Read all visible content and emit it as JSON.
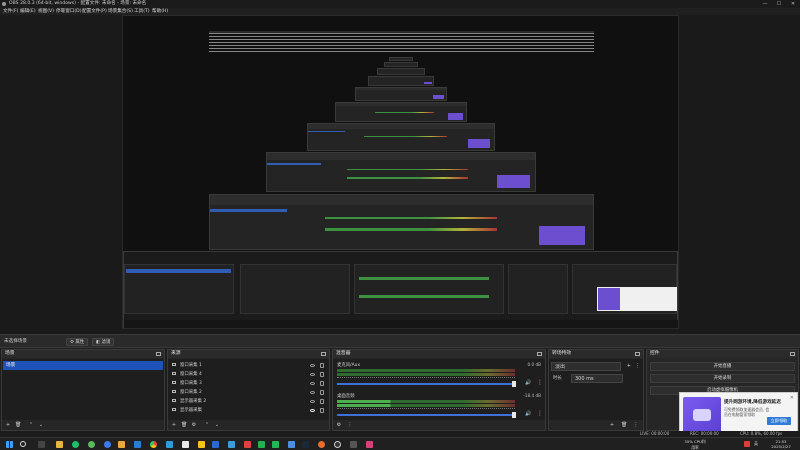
{
  "window": {
    "title": "OBS 28.0.3 (64-bit, windows) - 配置文件: 未命名 - 场景: 未命名",
    "controls": [
      "—",
      "☐",
      "✕"
    ]
  },
  "menu": [
    "文件(F)",
    "编辑(E)",
    "视图(V)",
    "停靠窗口(D)",
    "配置文件(P)",
    "场景集合(S)",
    "工具(T)",
    "帮助(H)"
  ],
  "scene_bar": {
    "label": "未选择场景",
    "buttons": [
      "属性",
      "滤镜"
    ]
  },
  "docks": {
    "scenes": {
      "title": "场景",
      "items": [
        "场景"
      ]
    },
    "sources": {
      "title": "来源",
      "items": [
        "窗口采集 1",
        "窗口采集 4",
        "窗口采集 3",
        "窗口采集 2",
        "显示器采集 2",
        "显示器采集"
      ]
    },
    "mixer": {
      "title": "混音器",
      "channels": [
        {
          "name": "桌面音频",
          "db": "-18.4 dB",
          "level": 0.3
        },
        {
          "name": "麦克风/Aux",
          "db": "0.0 dB",
          "level": 0.0
        }
      ]
    },
    "transitions": {
      "title": "转场特效",
      "type": "淡出",
      "duration_label": "时长",
      "duration": "300 ms"
    },
    "controls": {
      "title": "控件",
      "buttons": [
        "开始直播",
        "开始录制",
        "启动虚拟摄像机",
        "工作室模式",
        "设置",
        "退出"
      ]
    }
  },
  "notification": {
    "title": "提升网游环境,降低游戏延迟",
    "body": "可免费领取加速器会员, 会员在电脑管家领取",
    "cta": "立即领取"
  },
  "status": {
    "live": "LIVE: 00:00:00",
    "rec": "REC: 00:00:00",
    "cpu": "CPU: 0.8%, 60.00 fps"
  },
  "taskbar": {
    "clock_time": "21:53",
    "clock_date": "2025/2/27",
    "tray": "35% CPU利用率",
    "ime": "英"
  },
  "colors": {
    "accent": "#1f52b8",
    "background": "#1e1e1e",
    "panel": "#262626"
  }
}
